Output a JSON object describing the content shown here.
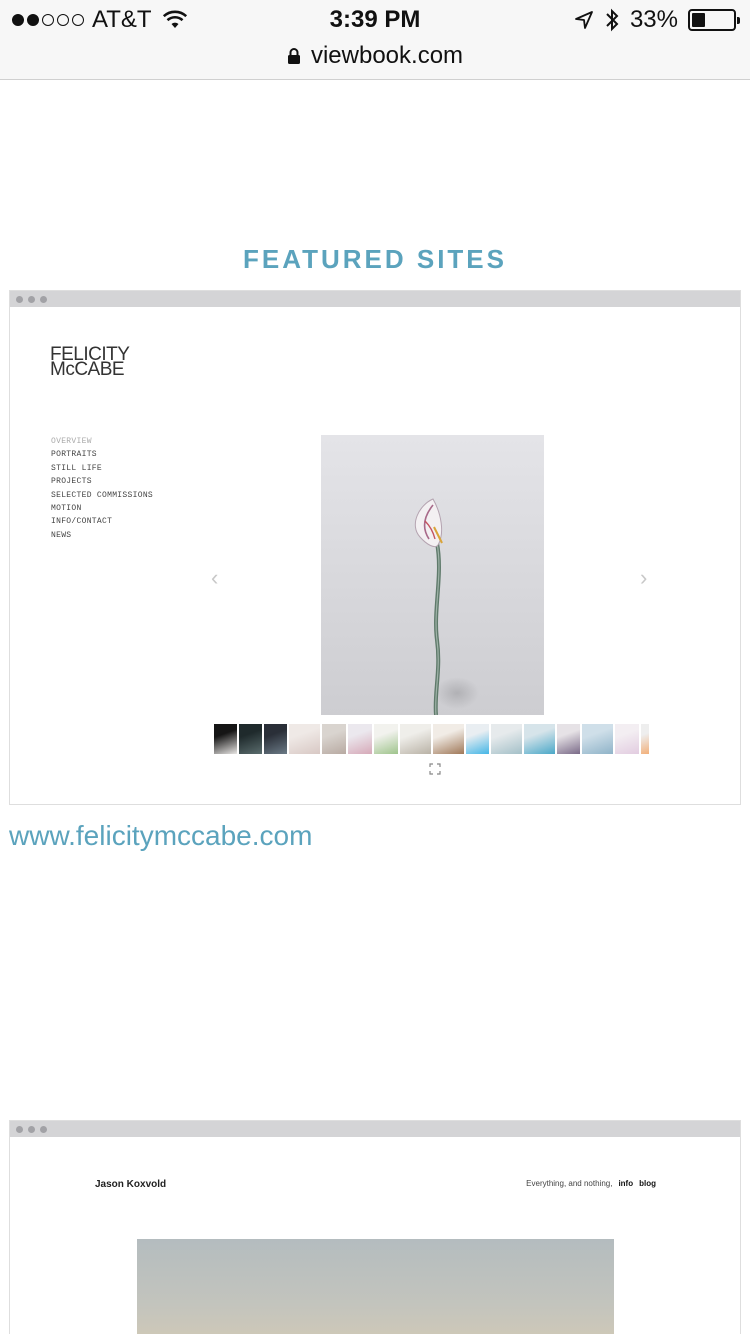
{
  "status_bar": {
    "carrier": "AT&T",
    "time": "3:39 PM",
    "battery_percent": "33%",
    "battery_level": 0.33,
    "signal_bars_filled": 2,
    "signal_bars_total": 5
  },
  "url_bar": {
    "url": "viewbook.com"
  },
  "section": {
    "heading": "FEATURED SITES"
  },
  "featured_sites": [
    {
      "logo_line1": "FELICITY",
      "logo_line2": "McCABE",
      "nav": [
        "OVERVIEW",
        "PORTRAITS",
        "STILL LIFE",
        "PROJECTS",
        "SELECTED COMMISSIONS",
        "MOTION",
        "INFO/CONTACT",
        "NEWS"
      ],
      "active_nav": "OVERVIEW",
      "thumbnail_count": 17,
      "link": "www.felicitymccabe.com"
    },
    {
      "name": "Jason Koxvold",
      "tagline": "Everything, and nothing,",
      "nav_info": "info",
      "nav_blog": "blog"
    }
  ],
  "colors": {
    "accent": "#5ba3bd",
    "chrome_bar": "#d4d4d6",
    "status_bg": "#f7f7f7"
  }
}
